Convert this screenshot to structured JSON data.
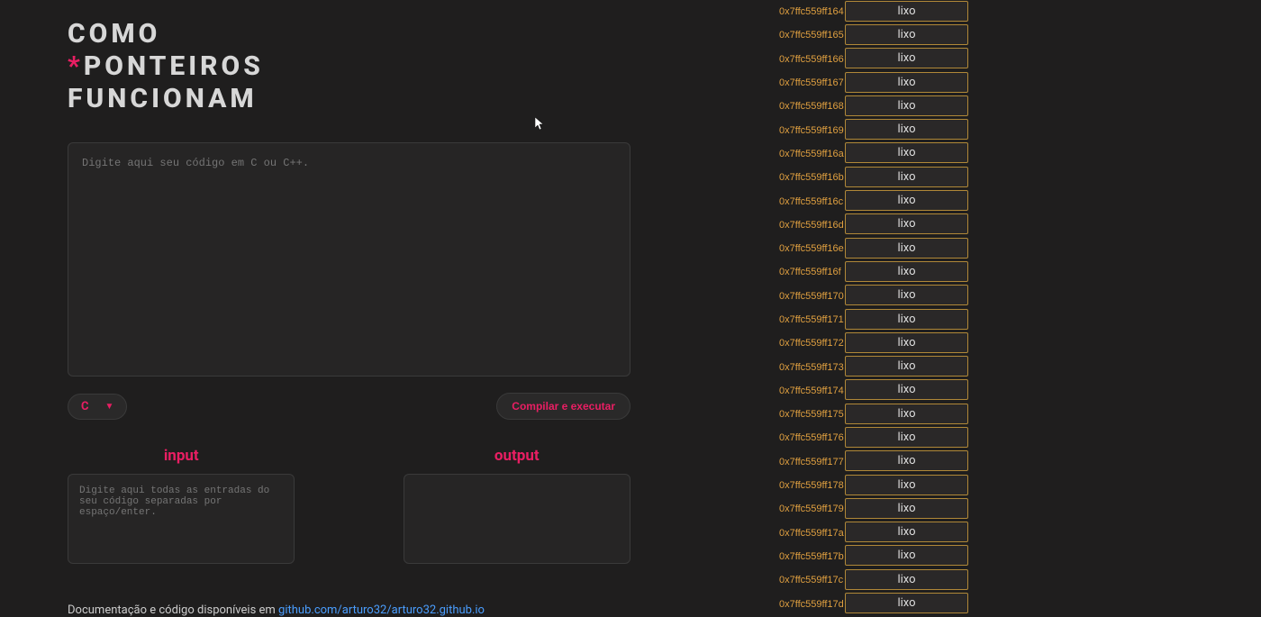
{
  "title": {
    "line1": "COMO",
    "asterisk": "*",
    "line2": "PONTEIROS",
    "line3": "FUNCIONAM"
  },
  "editor": {
    "placeholder": "Digite aqui seu código em C ou C++."
  },
  "controls": {
    "lang": "C",
    "compile_label": "Compilar e executar"
  },
  "io": {
    "input_label": "input",
    "output_label": "output",
    "input_placeholder": "Digite aqui todas as entradas do seu código separadas por espaço/enter."
  },
  "footer": {
    "prefix": "Documentação e código disponíveis em ",
    "link_text": "github.com/arturo32/arturo32.github.io"
  },
  "memory": {
    "cell_value": "lixo",
    "addresses": [
      "0x7ffc559ff164",
      "0x7ffc559ff165",
      "0x7ffc559ff166",
      "0x7ffc559ff167",
      "0x7ffc559ff168",
      "0x7ffc559ff169",
      "0x7ffc559ff16a",
      "0x7ffc559ff16b",
      "0x7ffc559ff16c",
      "0x7ffc559ff16d",
      "0x7ffc559ff16e",
      "0x7ffc559ff16f",
      "0x7ffc559ff170",
      "0x7ffc559ff171",
      "0x7ffc559ff172",
      "0x7ffc559ff173",
      "0x7ffc559ff174",
      "0x7ffc559ff175",
      "0x7ffc559ff176",
      "0x7ffc559ff177",
      "0x7ffc559ff178",
      "0x7ffc559ff179",
      "0x7ffc559ff17a",
      "0x7ffc559ff17b",
      "0x7ffc559ff17c",
      "0x7ffc559ff17d"
    ]
  }
}
